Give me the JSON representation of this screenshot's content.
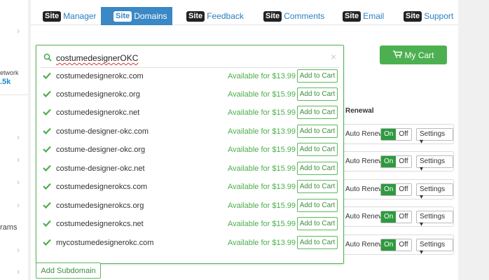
{
  "tabs": [
    {
      "badge": "Site",
      "label": "Manager",
      "active": false
    },
    {
      "badge": "Site",
      "label": "Domains",
      "active": true
    },
    {
      "badge": "Site",
      "label": "Feedback",
      "active": false
    },
    {
      "badge": "Site",
      "label": "Comments",
      "active": false
    },
    {
      "badge": "Site",
      "label": "Email",
      "active": false
    },
    {
      "badge": "Site",
      "label": "Support",
      "active": false
    }
  ],
  "sidebar": {
    "network_label": "etwork",
    "network_count": ".5k",
    "grams_label": "rams"
  },
  "cart": {
    "label": "My Cart"
  },
  "search": {
    "value": "costumedesignerOKC"
  },
  "results": [
    {
      "domain": "costumedesignerokc.com",
      "availability": "Available for $13.99",
      "button": "Add to Cart"
    },
    {
      "domain": "costumedesignerokc.org",
      "availability": "Available for $15.99",
      "button": "Add to Cart"
    },
    {
      "domain": "costumedesignerokc.net",
      "availability": "Available for $15.99",
      "button": "Add to Cart"
    },
    {
      "domain": "costume-designer-okc.com",
      "availability": "Available for $13.99",
      "button": "Add to Cart"
    },
    {
      "domain": "costume-designer-okc.org",
      "availability": "Available for $15.99",
      "button": "Add to Cart"
    },
    {
      "domain": "costume-designer-okc.net",
      "availability": "Available for $15.99",
      "button": "Add to Cart"
    },
    {
      "domain": "costumedesignerokcs.com",
      "availability": "Available for $13.99",
      "button": "Add to Cart"
    },
    {
      "domain": "costumedesignerokcs.org",
      "availability": "Available for $15.99",
      "button": "Add to Cart"
    },
    {
      "domain": "costumedesignerokcs.net",
      "availability": "Available for $15.99",
      "button": "Add to Cart"
    },
    {
      "domain": "mycostumedesignerokc.com",
      "availability": "Available for $13.99",
      "button": "Add to Cart"
    }
  ],
  "renewal": {
    "header": "Renewal",
    "rows": [
      {
        "label": "Auto Renew",
        "on": "On",
        "off": "Off",
        "settings": "Settings"
      },
      {
        "label": "Auto Renew",
        "on": "On",
        "off": "Off",
        "settings": "Settings"
      },
      {
        "label": "Auto Renew",
        "on": "On",
        "off": "Off",
        "settings": "Settings"
      },
      {
        "label": "Auto Renew",
        "on": "On",
        "off": "Off",
        "settings": "Settings"
      },
      {
        "label": "Auto Renew",
        "on": "On",
        "off": "Off",
        "settings": "Settings"
      }
    ]
  },
  "subdomain": {
    "label": "Add Subdomain"
  },
  "colors": {
    "accent_blue": "#3a88c6",
    "green": "#4cb050",
    "available_green": "#4cae4c"
  }
}
